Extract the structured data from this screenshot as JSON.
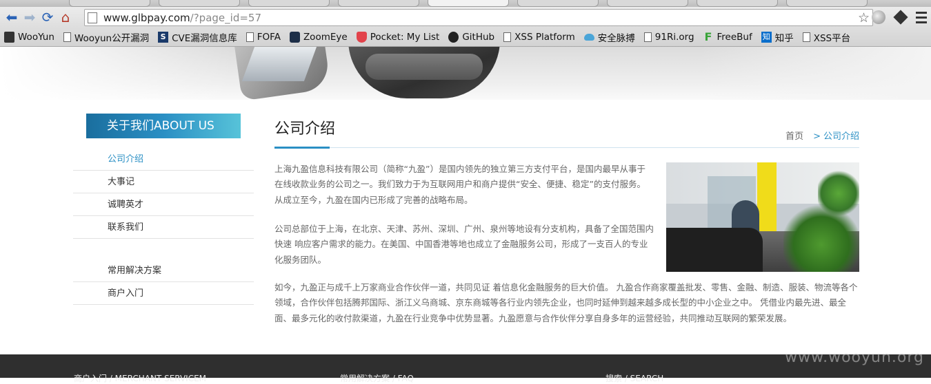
{
  "browser": {
    "url_host": "www.glbpay.com",
    "url_path": "/?page_id=57",
    "bookmarks": [
      {
        "label": "WooYun",
        "icon": "wooyun-icon"
      },
      {
        "label": "Wooyun公开漏洞",
        "icon": "page-icon"
      },
      {
        "label": "CVE漏洞信息库",
        "icon": "cve-icon"
      },
      {
        "label": "FOFA",
        "icon": "page-icon"
      },
      {
        "label": "ZoomEye",
        "icon": "zoomeye-icon"
      },
      {
        "label": "Pocket: My List",
        "icon": "pocket-icon"
      },
      {
        "label": "GitHub",
        "icon": "github-icon"
      },
      {
        "label": "XSS Platform",
        "icon": "page-icon"
      },
      {
        "label": "安全脉搏",
        "icon": "cloud-icon"
      },
      {
        "label": "91Ri.org",
        "icon": "page-icon"
      },
      {
        "label": "FreeBuf",
        "icon": "freebuf-icon"
      },
      {
        "label": "知乎",
        "icon": "zhihu-icon"
      },
      {
        "label": "XSS平台",
        "icon": "page-icon"
      }
    ]
  },
  "sidebar": {
    "header": "关于我们ABOUT US",
    "items": [
      {
        "label": "公司介绍",
        "active": true
      },
      {
        "label": "大事记",
        "active": false
      },
      {
        "label": "诚聘英才",
        "active": false
      },
      {
        "label": "联系我们",
        "active": false
      }
    ],
    "items2": [
      {
        "label": "常用解决方案"
      },
      {
        "label": "商户入门"
      }
    ]
  },
  "main": {
    "title": "公司介绍",
    "breadcrumb": {
      "home": "首页",
      "separator": ">",
      "current": "公司介绍"
    },
    "paragraphs": [
      "上海九盈信息科技有限公司（简称“九盈”）是国内领先的独立第三方支付平台，是国内最早从事于在线收款业务的公司之一。我们致力于为互联网用户和商户提供“安全、便捷、稳定”的支付服务。 从成立至今，九盈在国内已形成了完善的战略布局。",
      "公司总部位于上海，在北京、天津、苏州、深圳、广州、泉州等地设有分支机构，具备了全国范围内快速 响应客户需求的能力。在美国、中国香港等地也成立了金融服务公司，形成了一支百人的专业化服务团队。",
      "如今，九盈正与成千上万家商业合作伙伴一道，共同见证 着信息化金融服务的巨大价值。 九盈合作商家覆盖批发、零售、金融、制造、服装、物流等各个领域，合作伙伴包括腾邦国际、浙江义乌商城、京东商城等各行业内领先企业，也同时延伸到越来越多成长型的中小企业之中。 凭借业内最先进、最全面、最多元化的收付款渠道，九盈在行业竞争中优势显著。九盈愿意与合作伙伴分享自身多年的运营经验，共同推动互联网的繁荣发展。"
    ]
  },
  "footer": {
    "col1": "商户入门 / MERCHANT SERVICEM",
    "col2": "常用解决方案 / FAQ",
    "col3": "搜索 / SEARCH"
  },
  "watermark": "www.wooyun.org",
  "colors": {
    "accent": "#2a8fc4",
    "footer_bg": "#2f2f2f"
  }
}
